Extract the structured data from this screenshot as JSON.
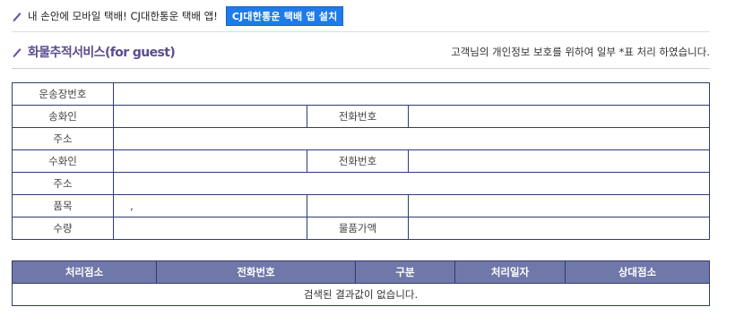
{
  "promo": {
    "text": "내 손안에 모바일 택배! CJ대한통운 택배 앱!",
    "button_label": "CJ대한통운 택배 앱 설치"
  },
  "section": {
    "title": "화물추적서비스(for guest)",
    "privacy_note": "고객님의 개인정보 보호를 위하여 일부 *표 처리 하였습니다."
  },
  "info": {
    "waybill_label": "운송장번호",
    "sender_label": "송화인",
    "sender_phone_label": "전화번호",
    "sender_address_label": "주소",
    "receiver_label": "수화인",
    "receiver_phone_label": "전화번호",
    "receiver_address_label": "주소",
    "item_label": "품목",
    "item_value": ",",
    "qty_label": "수량",
    "price_label": "물품가액"
  },
  "results": {
    "headers": [
      "처리점소",
      "전화번호",
      "구분",
      "처리일자",
      "상대점소"
    ],
    "empty_message": "검색된 결과값이 없습니다."
  },
  "colors": {
    "accent_purple": "#5b4d8e",
    "header_bg": "#6f78a9",
    "table_border": "#2f3b73",
    "button_blue": "#1e7be8"
  }
}
